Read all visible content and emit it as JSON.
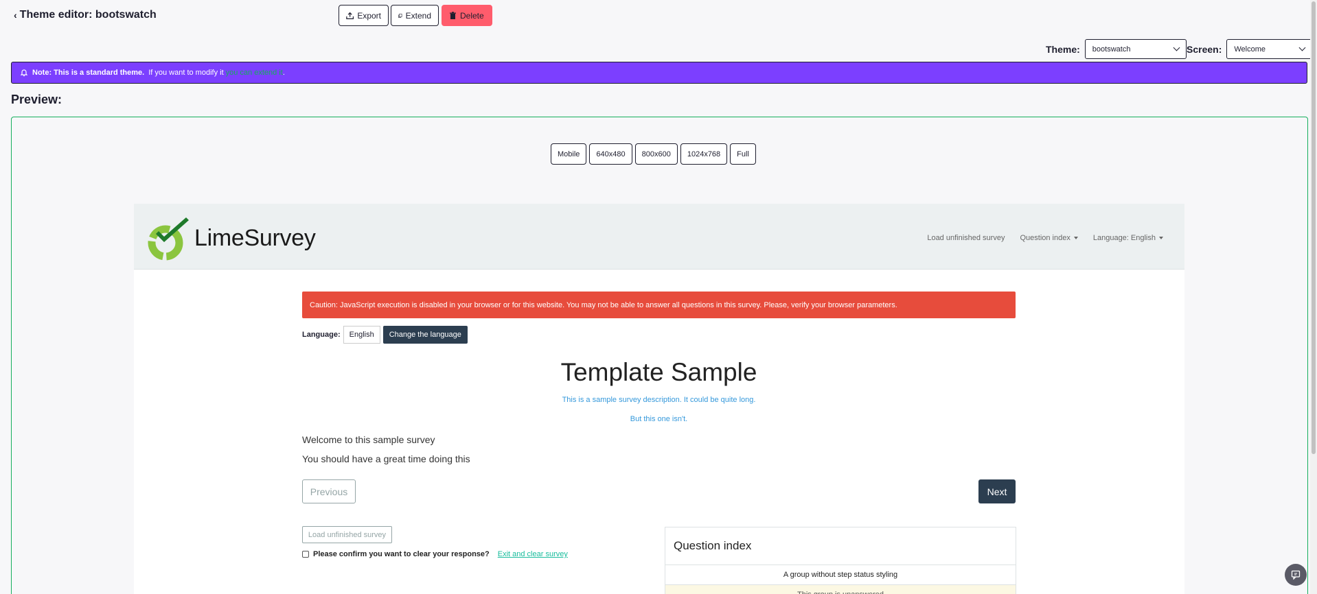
{
  "header": {
    "title": "Theme editor: bootswatch",
    "buttons": {
      "export": "Export",
      "extend": "Extend",
      "delete": "Delete"
    }
  },
  "selectors": {
    "theme_label": "Theme:",
    "theme_value": "bootswatch",
    "screen_label": "Screen:",
    "screen_value": "Welcome"
  },
  "note": {
    "bold": "Note: This is a standard theme.",
    "text": "If you want to modify it",
    "link": "you can extend it",
    "end": "."
  },
  "preview": {
    "label": "Preview:",
    "sizes": [
      "Mobile",
      "640x480",
      "800x600",
      "1024x768",
      "Full"
    ]
  },
  "survey": {
    "logo_text": "LimeSurvey",
    "nav": {
      "load": "Load unfinished survey",
      "qindex": "Question index",
      "language": "Language: English"
    },
    "alert": "Caution: JavaScript execution is disabled in your browser or for this website. You may not be able to answer all questions in this survey. Please, verify your browser parameters.",
    "language_label": "Language:",
    "language_value": "English",
    "change_language": "Change the language",
    "title": "Template Sample",
    "description_1": "This is a sample survey description. It could be quite long.",
    "description_2": "But this one isn't.",
    "welcome_1": "Welcome to this sample survey",
    "welcome_2": "You should have a great time doing this",
    "previous": "Previous",
    "next": "Next",
    "load_button": "Load unfinished survey",
    "clear_label": "Please confirm you want to clear your response?",
    "exit_link": "Exit and clear survey",
    "question_index": {
      "title": "Question index",
      "row_1": "A group without step status styling",
      "row_2": "This group is unanswered"
    }
  },
  "colors": {
    "note_bg": "#7c3fff",
    "delete_bg": "#ff5c6c",
    "accent_green": "#14ae5c",
    "alert_red": "#e74c3c",
    "survey_dark": "#2c3e50"
  }
}
